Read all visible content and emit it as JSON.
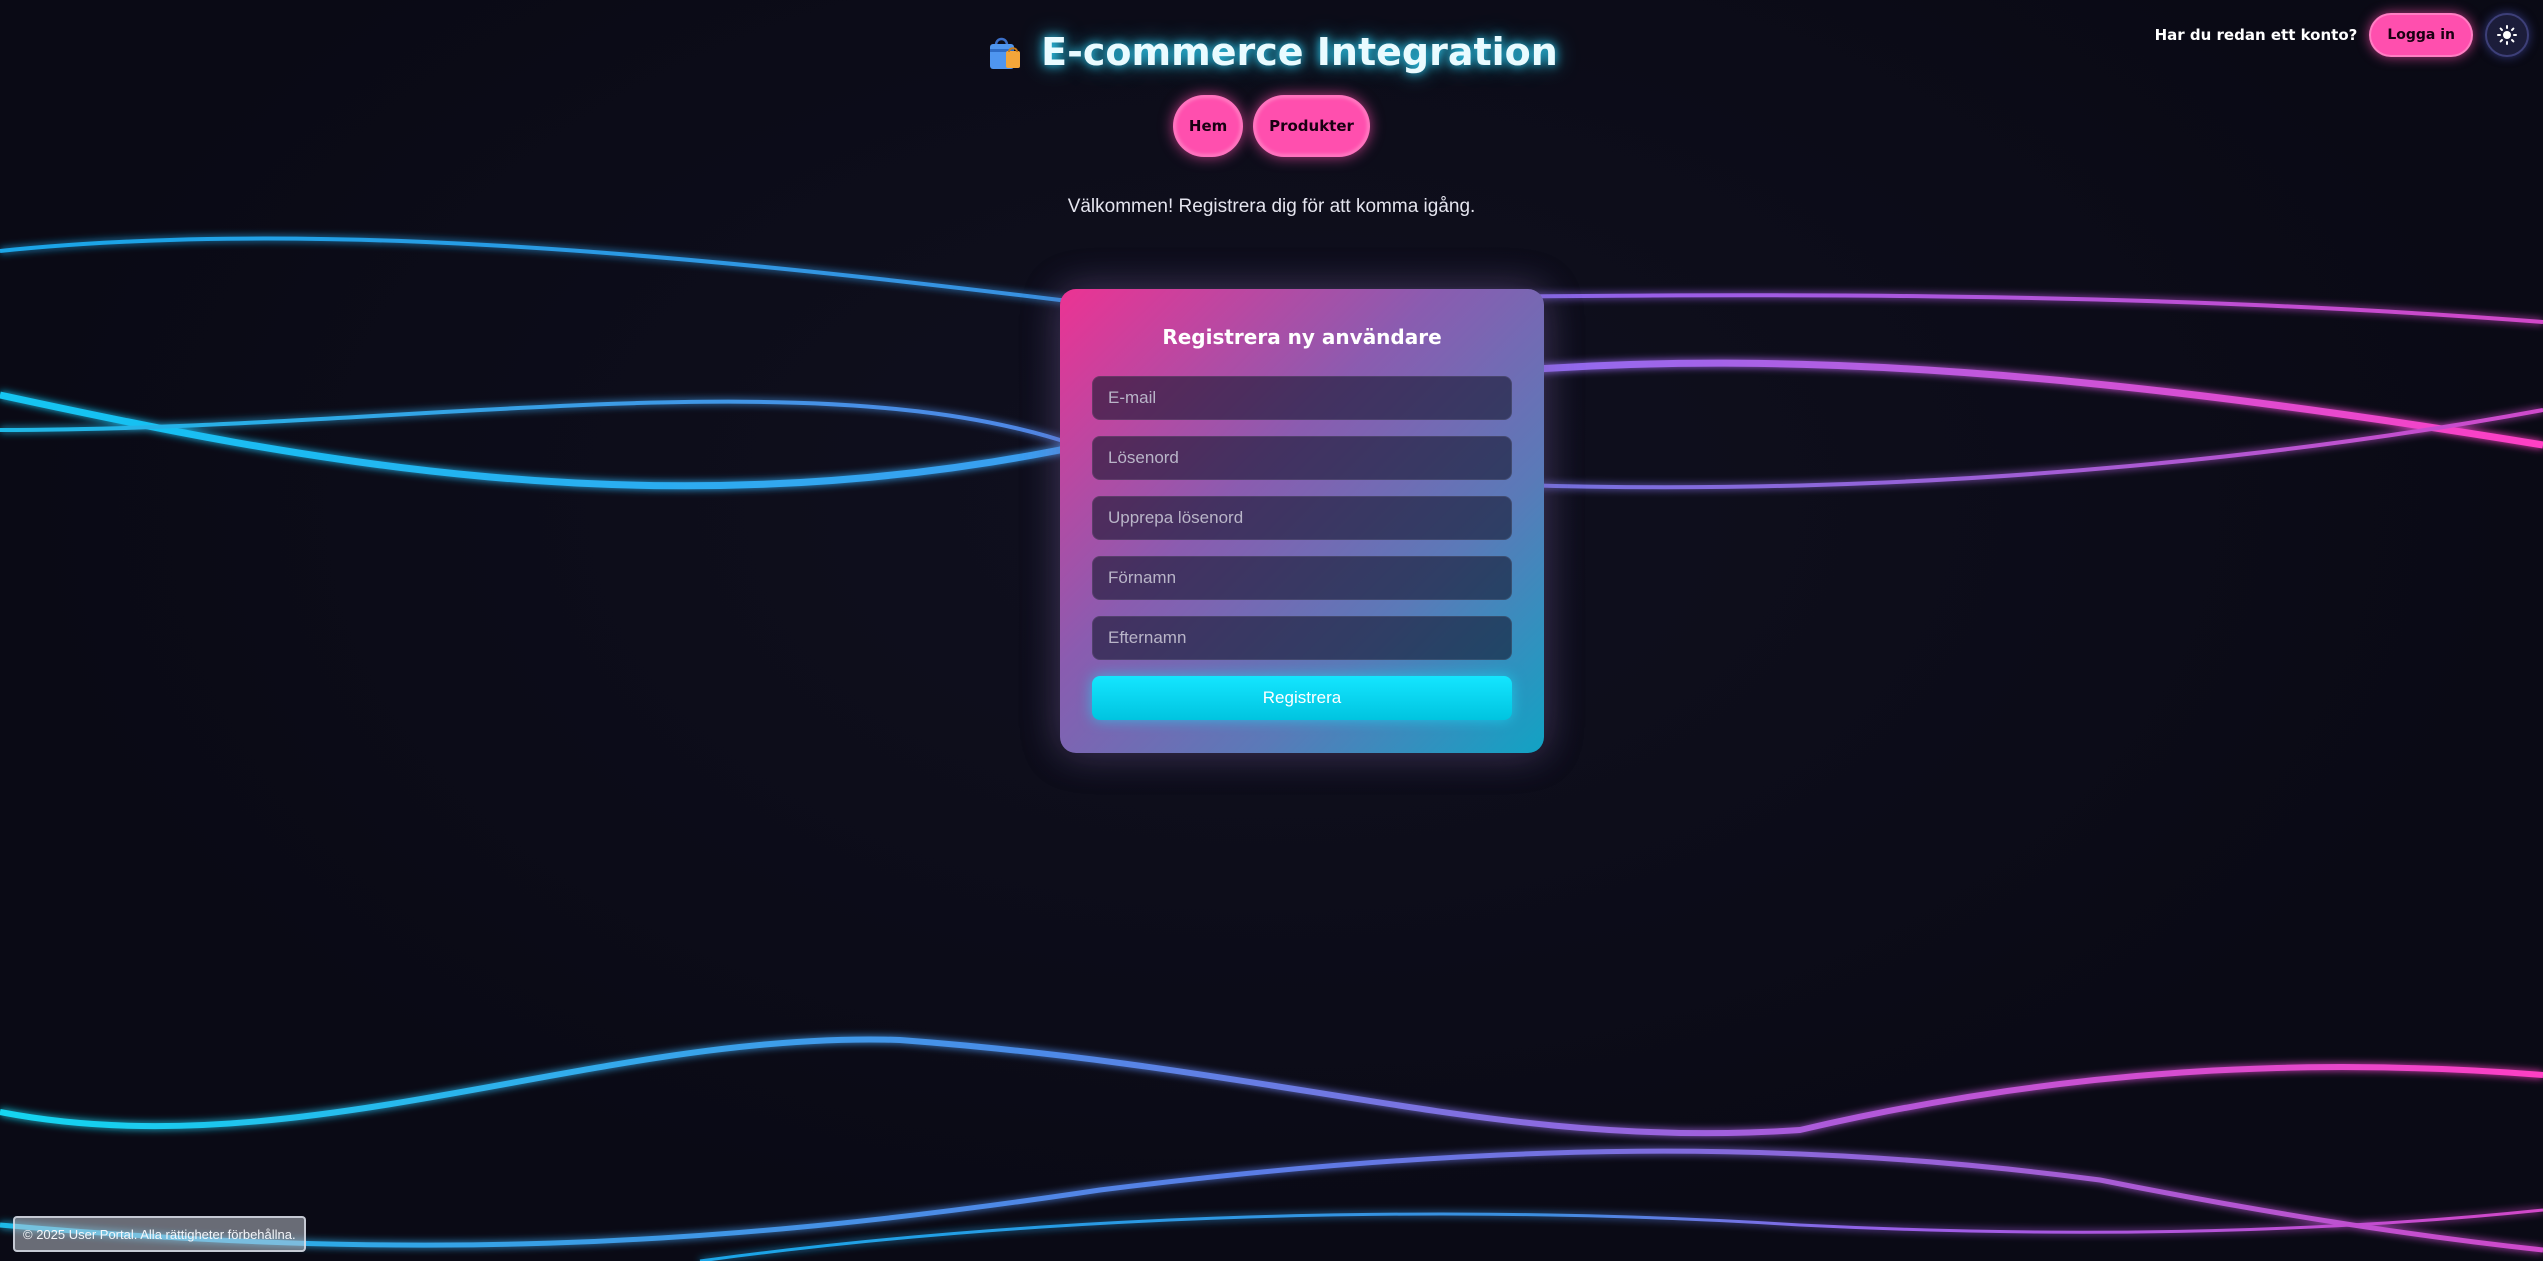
{
  "header": {
    "title": "E-commerce Integration",
    "brand_icon": "shopping-bag-icon"
  },
  "nav": {
    "items": [
      {
        "label": "Hem"
      },
      {
        "label": "Produkter"
      }
    ]
  },
  "account": {
    "prompt": "Har du redan ett konto?",
    "login_label": "Logga in",
    "theme_icon": "sun-icon"
  },
  "welcome_text": "Välkommen! Registrera dig för att komma igång.",
  "form": {
    "title": "Registrera ny användare",
    "fields": {
      "email": {
        "placeholder": "E-mail",
        "value": ""
      },
      "password": {
        "placeholder": "Lösenord",
        "value": ""
      },
      "password_repeat": {
        "placeholder": "Upprepa lösenord",
        "value": ""
      },
      "first_name": {
        "placeholder": "Förnamn",
        "value": ""
      },
      "last_name": {
        "placeholder": "Efternamn",
        "value": ""
      }
    },
    "submit_label": "Registrera"
  },
  "footer": {
    "text": "© 2025 User Portal. Alla rättigheter förbehållna."
  },
  "colors": {
    "background": "#0b0b17",
    "accent_pink": "#ff4fae",
    "accent_cyan": "#14e6ff",
    "title_glow": "#2ed8ff"
  }
}
